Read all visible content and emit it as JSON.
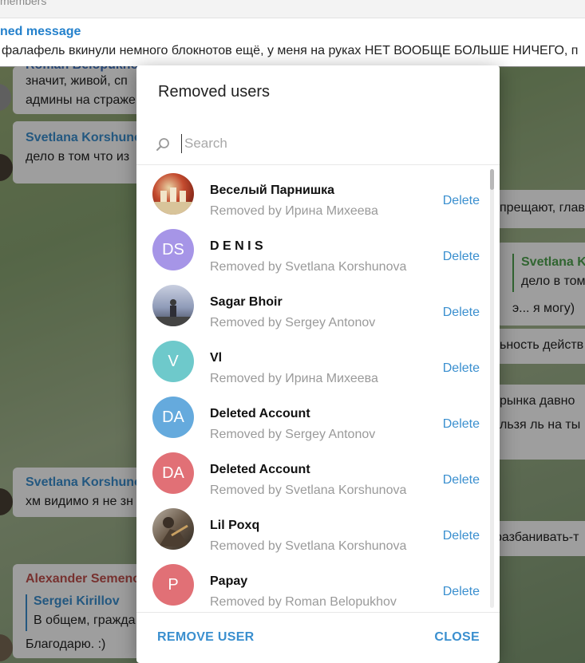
{
  "background_chat": {
    "topbar_text": "members",
    "pinned_title": "ned message",
    "pinned_text": "фалафель вкинули немного блокнотов ещё, у меня на руках НЕТ ВООБЩЕ БОЛЬШЕ НИЧЕГО, п",
    "left_bubbles": [
      {
        "name": "Roman Belopukho",
        "lines": [
          "значит, живой, сп",
          "админы на страже"
        ]
      },
      {
        "name": "Svetlana Korshuno",
        "lines": [
          "дело в том что из"
        ]
      },
      {
        "name": "Svetlana Korshuno",
        "lines": [
          "хм видимо я не зн"
        ]
      },
      {
        "name": "Alexander Semeno",
        "reply_name": "Sergei Kirillov",
        "reply_text": "В общем, гражда",
        "lines": [
          "Благодарю. :)"
        ]
      }
    ],
    "right_fragments": [
      "прещают, глав",
      "Svetlana K",
      "дело в том",
      "э... я могу)",
      "ьность действ",
      "рынка давно",
      "льзя ль на ты",
      "разбанивать-т"
    ]
  },
  "dialog": {
    "title": "Removed users",
    "search_placeholder": "Search",
    "search_value": "",
    "users": [
      {
        "name": "Веселый Парнишка",
        "removed_by": "Removed by Ирина Михеева",
        "initials": "",
        "avatar_color": "#c44b2f",
        "photo": true,
        "delete_label": "Delete"
      },
      {
        "name": "D E N I S",
        "removed_by": "Removed by Svetlana Korshunova",
        "initials": "DS",
        "avatar_color": "#a695e7",
        "photo": false,
        "delete_label": "Delete"
      },
      {
        "name": "Sagar Bhoir",
        "removed_by": "Removed by Sergey Antonov",
        "initials": "",
        "avatar_color": "#7a8aa8",
        "photo": true,
        "delete_label": "Delete"
      },
      {
        "name": "Vl",
        "removed_by": "Removed by Ирина Михеева",
        "initials": "V",
        "avatar_color": "#6ec9cb",
        "photo": false,
        "delete_label": "Delete"
      },
      {
        "name": "Deleted Account",
        "removed_by": "Removed by Sergey Antonov",
        "initials": "DA",
        "avatar_color": "#65aadd",
        "photo": false,
        "delete_label": "Delete"
      },
      {
        "name": "Deleted Account",
        "removed_by": "Removed by Svetlana Korshunova",
        "initials": "DA",
        "avatar_color": "#e17076",
        "photo": false,
        "delete_label": "Delete"
      },
      {
        "name": "Lil Poxq",
        "removed_by": "Removed by Svetlana Korshunova",
        "initials": "",
        "avatar_color": "#6a5a4a",
        "photo": true,
        "delete_label": "Delete"
      },
      {
        "name": "Papay",
        "removed_by": "Removed by Roman Belopukhov",
        "initials": "P",
        "avatar_color": "#e17076",
        "photo": false,
        "delete_label": "Delete"
      }
    ],
    "remove_user_label": "REMOVE USER",
    "close_label": "CLOSE"
  },
  "colors": {
    "accent": "#3a8fcf",
    "chat_link": "#2481cc"
  },
  "icons": {
    "search": "search-icon"
  }
}
